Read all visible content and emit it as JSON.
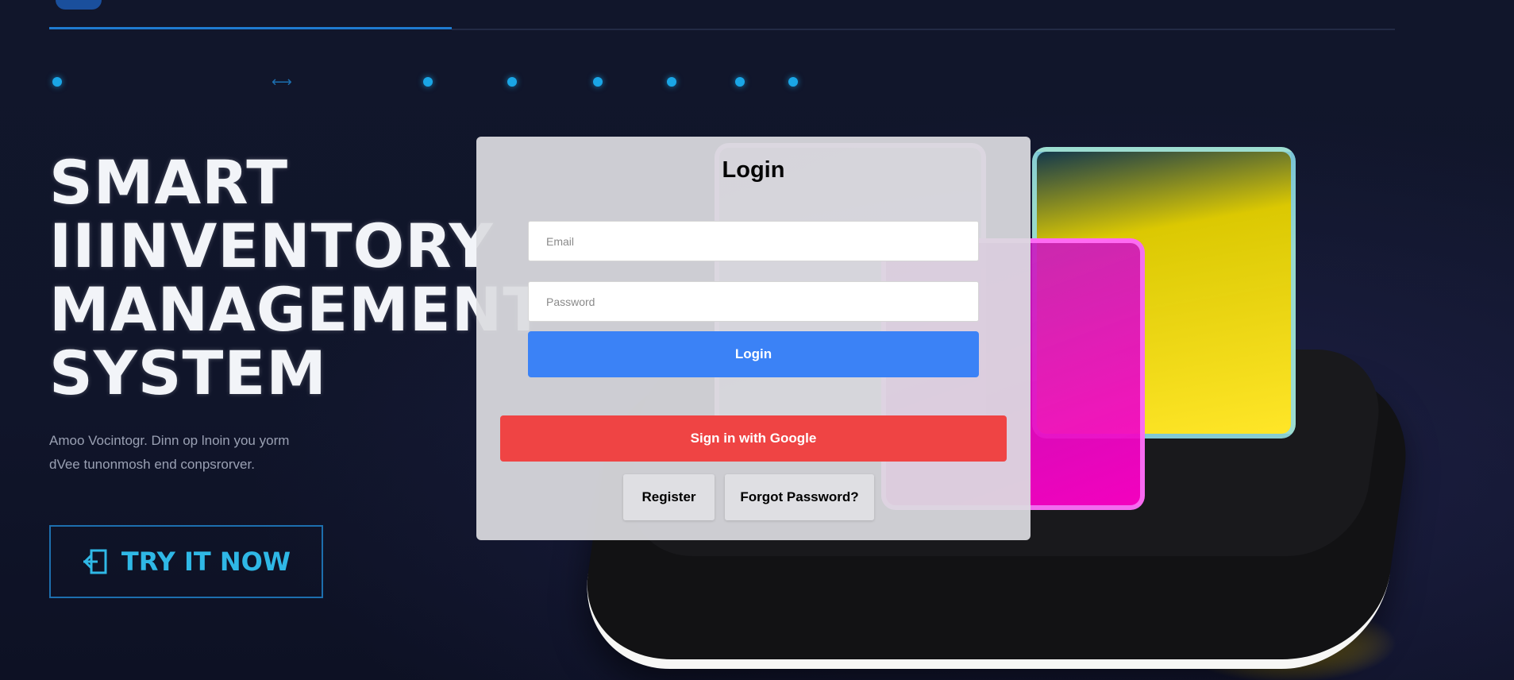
{
  "hero": {
    "title_lines": [
      "SMART",
      "IIINVENTORY",
      "MANAGEMENT",
      "SYSTEM"
    ],
    "subtitle_line1": "Amoo Vocintogr. Dinn op lnoin you yorm",
    "subtitle_line2": "dVee tunonmosh end conpsrorver.",
    "cta_label": "TRY IT NOW",
    "arrow_glyph": "⟷"
  },
  "login": {
    "title": "Login",
    "email_placeholder": "Email",
    "password_placeholder": "Password",
    "login_button": "Login",
    "google_button": "Sign in with Google",
    "register_button": "Register",
    "forgot_button": "Forgot Password?"
  },
  "colors": {
    "background": "#0f1428",
    "login_button": "#3b82f6",
    "google_button": "#ef4444",
    "accent_cyan": "#2fb8e6",
    "dot_blue": "#1aa6e6"
  },
  "icons": {
    "cta_icon": "enter-door-icon",
    "dots": "nav-dot-icon"
  }
}
